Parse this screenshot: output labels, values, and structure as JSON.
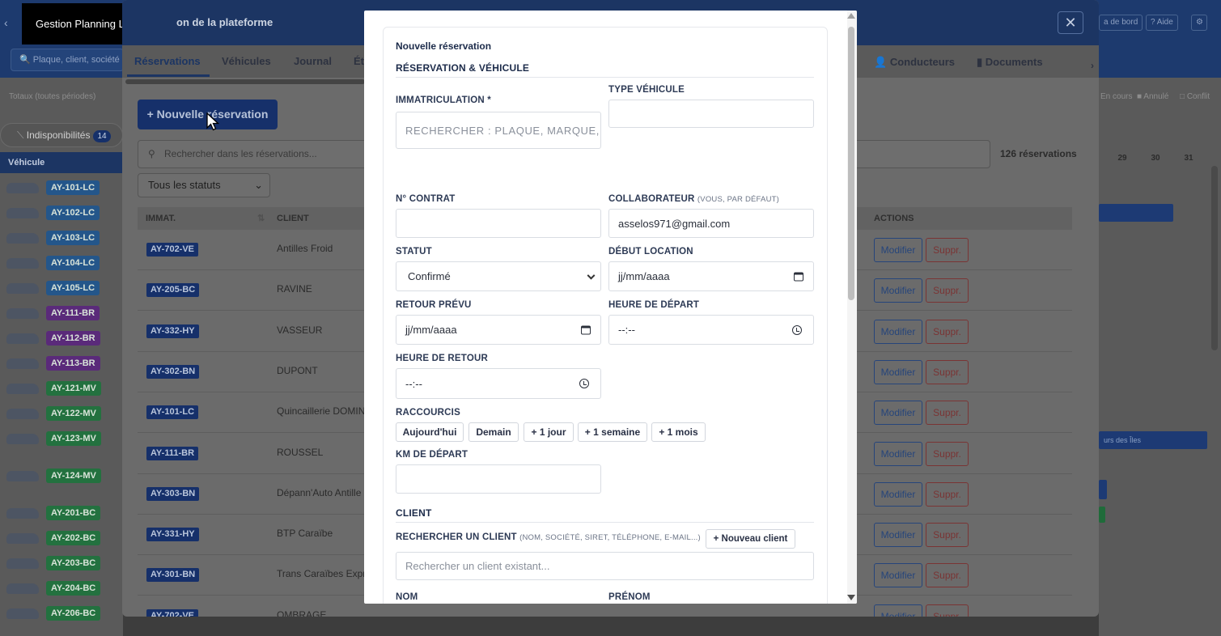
{
  "app": {
    "title": "Gestion Planning Lite",
    "search_placeholder": "Plaque, client, société"
  },
  "background": {
    "totaux": "Totaux (toutes périodes)",
    "indisponibilites": {
      "label": "Indisponibilités",
      "count": "14"
    },
    "vehicle_header": "Véhicule",
    "vehicles": [
      {
        "plate": "AY-101-LC",
        "color": "blue"
      },
      {
        "plate": "AY-102-LC",
        "color": "blue"
      },
      {
        "plate": "AY-103-LC",
        "color": "blue"
      },
      {
        "plate": "AY-104-LC",
        "color": "blue"
      },
      {
        "plate": "AY-105-LC",
        "color": "blue"
      },
      {
        "plate": "AY-111-BR",
        "color": "purple"
      },
      {
        "plate": "AY-112-BR",
        "color": "purple"
      },
      {
        "plate": "AY-113-BR",
        "color": "purple"
      },
      {
        "plate": "AY-121-MV",
        "color": "green"
      },
      {
        "plate": "AY-122-MV",
        "color": "green"
      },
      {
        "plate": "AY-123-MV",
        "color": "green"
      },
      {
        "plate": "AY-124-MV",
        "color": "green"
      },
      {
        "plate": "AY-201-BC",
        "color": "green"
      },
      {
        "plate": "AY-202-BC",
        "color": "green"
      },
      {
        "plate": "AY-203-BC",
        "color": "green"
      },
      {
        "plate": "AY-204-BC",
        "color": "green"
      },
      {
        "plate": "AY-206-BC",
        "color": "green"
      }
    ],
    "header_buttons": [
      "a de bord",
      "? Aide"
    ],
    "legend": {
      "en_cours": "En cours",
      "annule": "Annulé",
      "conflit": "Conflit"
    },
    "calendar_days": [
      {
        "d": "29"
      },
      {
        "d": "30"
      },
      {
        "d": "31"
      }
    ],
    "calendar_bar_text": "urs des Îles"
  },
  "panel": {
    "title": "on de la plateforme",
    "tabs": [
      "Réservations",
      "Véhicules",
      "Journal",
      "Ét"
    ],
    "tabs_right": [
      "Conducteurs",
      "Documents"
    ],
    "new_button": "+ Nouvelle réservation",
    "search_placeholder": "Rechercher dans les réservations...",
    "count": "126 réservations",
    "status_filter": "Tous les statuts",
    "columns": {
      "immat": "IMMAT.",
      "client": "CLIENT",
      "actions": "ACTIONS"
    },
    "rows": [
      {
        "plate": "AY-702-VE",
        "client": "Antilles Froid"
      },
      {
        "plate": "AY-205-BC",
        "client": "RAVINE"
      },
      {
        "plate": "AY-332-HY",
        "client": "VASSEUR"
      },
      {
        "plate": "AY-302-BN",
        "client": "DUPONT"
      },
      {
        "plate": "AY-101-LC",
        "client": "Quincaillerie DOMIN"
      },
      {
        "plate": "AY-111-BR",
        "client": "ROUSSEL"
      },
      {
        "plate": "AY-303-BN",
        "client": "Dépann'Auto Antille"
      },
      {
        "plate": "AY-331-HY",
        "client": "BTP Caraïbe"
      },
      {
        "plate": "AY-301-BN",
        "client": "Trans Caraïbes Expre"
      },
      {
        "plate": "AY-702-VE",
        "client": "OMBRAGE"
      }
    ],
    "row_actions": {
      "edit": "Modifier",
      "delete": "Suppr."
    }
  },
  "modal": {
    "title": "Nouvelle réservation",
    "section_vehicle": "RÉSERVATION & VÉHICULE",
    "immatriculation": {
      "label": "IMMATRICULATION *",
      "placeholder": "RECHERCHER : PLAQUE, MARQUE, I"
    },
    "type_vehicule": {
      "label": "TYPE VÉHICULE",
      "value": ""
    },
    "contrat": {
      "label": "N° CONTRAT",
      "value": ""
    },
    "collaborateur": {
      "label": "COLLABORATEUR",
      "hint": "(VOUS, PAR DÉFAUT)",
      "value": "asselos971@gmail.com"
    },
    "statut": {
      "label": "STATUT",
      "value": "Confirmé"
    },
    "debut": {
      "label": "DÉBUT LOCATION",
      "value": "jj/mm/aaaa"
    },
    "retour": {
      "label": "RETOUR PRÉVU",
      "value": "jj/mm/aaaa"
    },
    "heure_depart": {
      "label": "HEURE DE DÉPART",
      "value": "--:--"
    },
    "heure_retour": {
      "label": "HEURE DE RETOUR",
      "value": "--:--"
    },
    "raccourcis": {
      "label": "RACCOURCIS",
      "items": [
        "Aujourd'hui",
        "Demain",
        "+ 1 jour",
        "+ 1 semaine",
        "+ 1 mois"
      ]
    },
    "km_depart": {
      "label": "KM DE DÉPART",
      "value": ""
    },
    "section_client": "CLIENT",
    "client_search": {
      "label": "RECHERCHER UN CLIENT",
      "hint": "(NOM, SOCIÉTÉ, SIRET, TÉLÉPHONE, E-MAIL...)",
      "placeholder": "Rechercher un client existant...",
      "new_button": "+ Nouveau client"
    },
    "nom": {
      "label": "NOM"
    },
    "prenom": {
      "label": "PRÉNOM"
    }
  }
}
